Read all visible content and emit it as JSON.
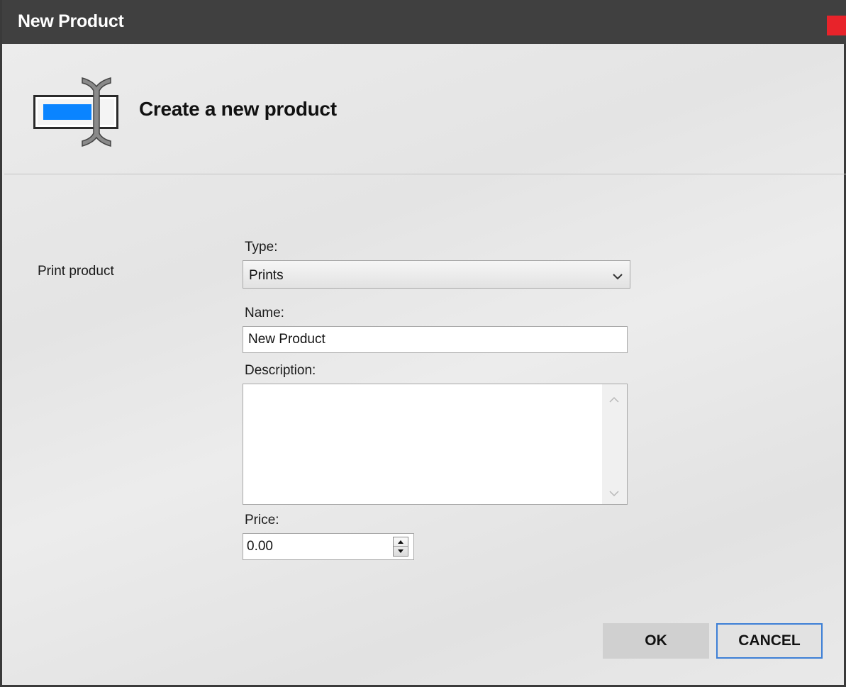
{
  "window": {
    "title": "New Product"
  },
  "header": {
    "heading": "Create a new product"
  },
  "form": {
    "section_label": "Print product",
    "type": {
      "label": "Type:",
      "value": "Prints"
    },
    "name": {
      "label": "Name:",
      "value": "New Product"
    },
    "description": {
      "label": "Description:",
      "value": ""
    },
    "price": {
      "label": "Price:",
      "value": "0.00"
    }
  },
  "buttons": {
    "ok": "OK",
    "cancel": "CANCEL"
  },
  "icons": {
    "window_close": "close-icon",
    "header": "text-field-icon",
    "dropdown": "chevron-down-icon",
    "scroll_up": "chevron-up-icon",
    "scroll_down": "chevron-down-icon",
    "spin_up": "triangle-up-icon",
    "spin_down": "triangle-down-icon"
  },
  "colors": {
    "titlebar": "#404040",
    "close": "#e8232a",
    "accent": "#3d7fd6",
    "icon_blue": "#0a84ff"
  }
}
